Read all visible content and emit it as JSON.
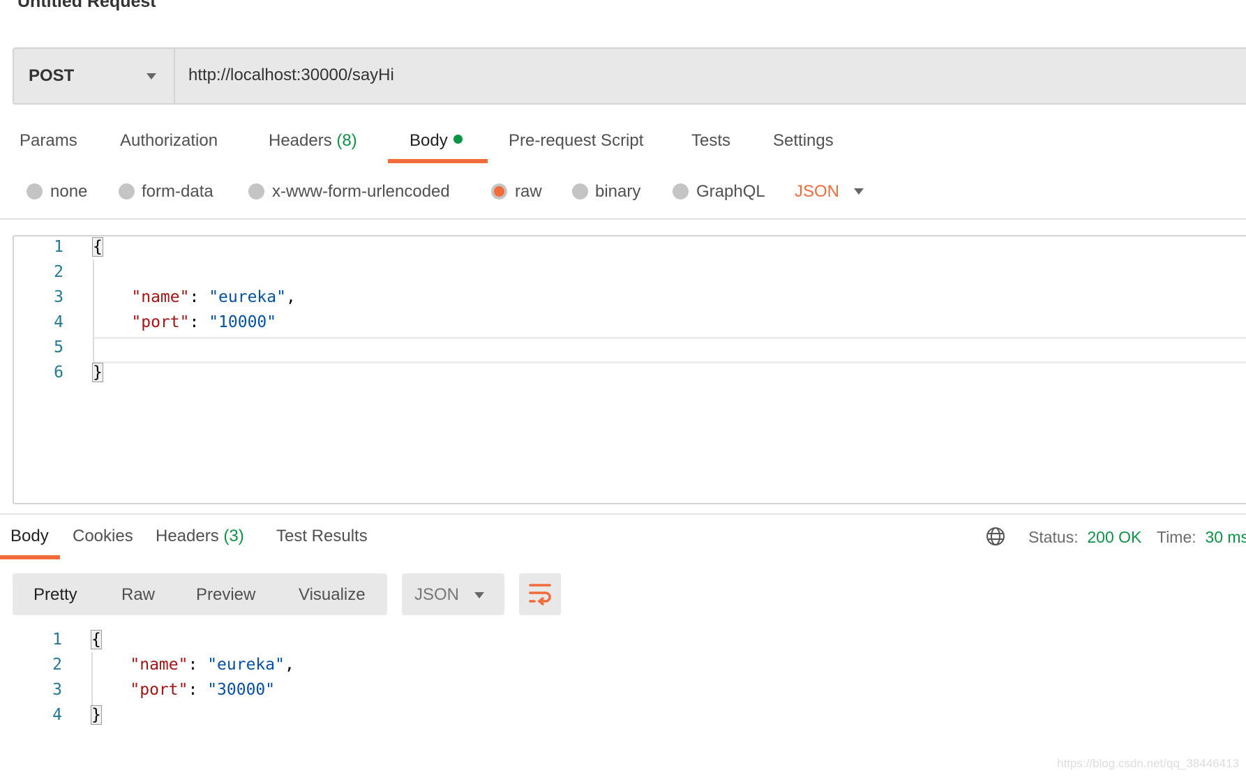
{
  "request": {
    "title": "Untitled Request",
    "method": "POST",
    "url": "http://localhost:30000/sayHi",
    "tabs": [
      {
        "label": "Params"
      },
      {
        "label": "Authorization"
      },
      {
        "label": "Headers",
        "count": "(8)"
      },
      {
        "label": "Body",
        "active": true,
        "indicator": "green-dot"
      },
      {
        "label": "Pre-request Script"
      },
      {
        "label": "Tests"
      },
      {
        "label": "Settings"
      }
    ],
    "body_types": [
      {
        "label": "none",
        "selected": false
      },
      {
        "label": "form-data",
        "selected": false
      },
      {
        "label": "x-www-form-urlencoded",
        "selected": false
      },
      {
        "label": "raw",
        "selected": true
      },
      {
        "label": "binary",
        "selected": false
      },
      {
        "label": "GraphQL",
        "selected": false
      }
    ],
    "format": "JSON",
    "code": [
      [
        {
          "t": "{",
          "c": "brace"
        }
      ],
      [],
      [
        {
          "t": "    "
        },
        {
          "t": "\"name\"",
          "c": "k"
        },
        {
          "t": ": "
        },
        {
          "t": "\"eureka\"",
          "c": "v"
        },
        {
          "t": ","
        }
      ],
      [
        {
          "t": "    "
        },
        {
          "t": "\"port\"",
          "c": "k"
        },
        {
          "t": ": "
        },
        {
          "t": "\"10000\"",
          "c": "v"
        }
      ],
      [],
      [
        {
          "t": "}",
          "c": "brace"
        }
      ]
    ]
  },
  "response": {
    "tabs": [
      {
        "label": "Body",
        "active": true
      },
      {
        "label": "Cookies"
      },
      {
        "label": "Headers",
        "count": "(3)"
      },
      {
        "label": "Test Results"
      }
    ],
    "status_label": "Status:",
    "status_value": "200 OK",
    "time_label": "Time:",
    "time_value": "30 ms",
    "views": [
      "Pretty",
      "Raw",
      "Preview",
      "Visualize"
    ],
    "format": "JSON",
    "code": [
      [
        {
          "t": "{",
          "c": "brace"
        }
      ],
      [
        {
          "t": "    "
        },
        {
          "t": "\"name\"",
          "c": "k"
        },
        {
          "t": ": "
        },
        {
          "t": "\"eureka\"",
          "c": "v"
        },
        {
          "t": ","
        }
      ],
      [
        {
          "t": "    "
        },
        {
          "t": "\"port\"",
          "c": "k"
        },
        {
          "t": ": "
        },
        {
          "t": "\"30000\"",
          "c": "v"
        }
      ],
      [
        {
          "t": "}",
          "c": "brace"
        }
      ]
    ]
  },
  "watermark": "https://blog.csdn.net/qq_38446413",
  "colors": {
    "accent": "#f26b3a",
    "success": "#0b9445",
    "json_key": "#a31515",
    "json_value": "#0451a5"
  }
}
